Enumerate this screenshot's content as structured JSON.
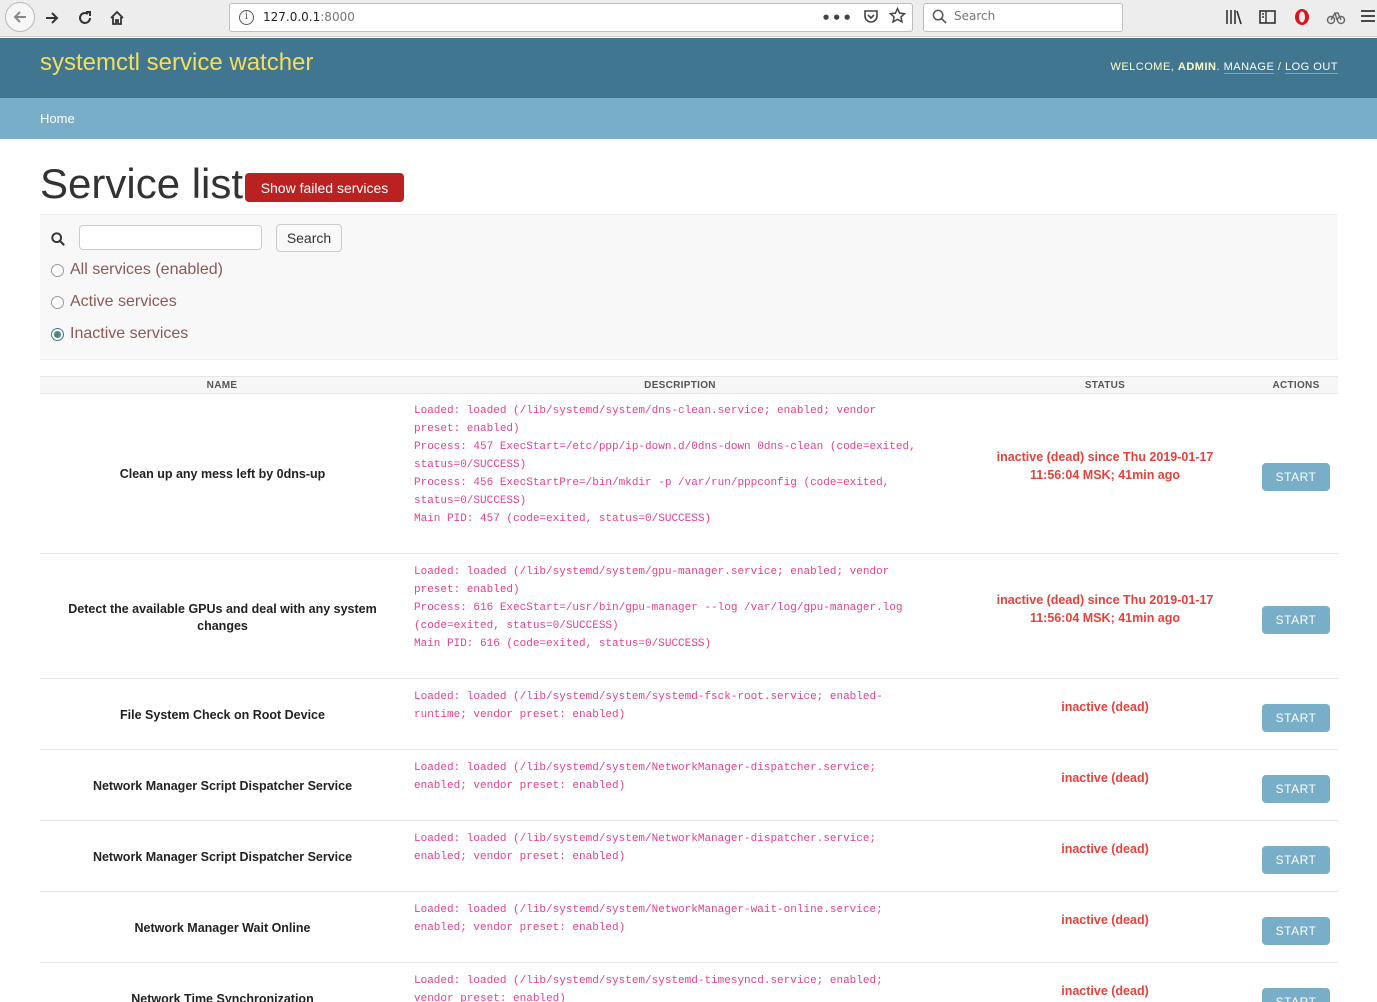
{
  "browser": {
    "url_host": "127.0.0.1",
    "url_port": ":8000",
    "search_placeholder": "Search"
  },
  "header": {
    "site_title": "systemctl service watcher",
    "welcome": "WELCOME,",
    "username": "ADMIN",
    "manage": "MANAGE",
    "separator": "/",
    "logout": "LOG OUT"
  },
  "breadcrumb": {
    "home": "Home"
  },
  "main": {
    "title": "Service list",
    "failed_button": "Show failed services"
  },
  "filter": {
    "search_value": "",
    "search_button": "Search",
    "options": [
      {
        "label": "All services (enabled)",
        "checked": false
      },
      {
        "label": "Active services",
        "checked": false
      },
      {
        "label": "Inactive services",
        "checked": true
      }
    ]
  },
  "table": {
    "headers": {
      "name": "NAME",
      "description": "DESCRIPTION",
      "status": "STATUS",
      "actions": "ACTIONS"
    },
    "rows": [
      {
        "name": "Clean up any mess left by 0dns-up",
        "description": "Loaded: loaded (/lib/systemd/system/dns-clean.service; enabled; vendor\npreset: enabled)\nProcess: 457 ExecStart=/etc/ppp/ip-down.d/0dns-down 0dns-clean (code=exited,\nstatus=0/SUCCESS)\nProcess: 456 ExecStartPre=/bin/mkdir -p /var/run/pppconfig (code=exited,\nstatus=0/SUCCESS)\nMain PID: 457 (code=exited, status=0/SUCCESS)",
        "status": "inactive (dead) since Thu 2019-01-17\n11:56:04 MSK; 41min ago",
        "action": "START"
      },
      {
        "name": "Detect the available GPUs and deal with any system\nchanges",
        "description": "Loaded: loaded (/lib/systemd/system/gpu-manager.service; enabled; vendor\npreset: enabled)\nProcess: 616 ExecStart=/usr/bin/gpu-manager --log /var/log/gpu-manager.log\n(code=exited, status=0/SUCCESS)\nMain PID: 616 (code=exited, status=0/SUCCESS)",
        "status": "inactive (dead) since Thu 2019-01-17\n11:56:04 MSK; 41min ago",
        "action": "START"
      },
      {
        "name": "File System Check on Root Device",
        "description": "Loaded: loaded (/lib/systemd/system/systemd-fsck-root.service; enabled-\nruntime; vendor preset: enabled)",
        "status": "inactive (dead)",
        "action": "START"
      },
      {
        "name": "Network Manager Script Dispatcher Service",
        "description": "Loaded: loaded (/lib/systemd/system/NetworkManager-dispatcher.service;\nenabled; vendor preset: enabled)",
        "status": "inactive (dead)",
        "action": "START"
      },
      {
        "name": "Network Manager Script Dispatcher Service",
        "description": "Loaded: loaded (/lib/systemd/system/NetworkManager-dispatcher.service;\nenabled; vendor preset: enabled)",
        "status": "inactive (dead)",
        "action": "START"
      },
      {
        "name": "Network Manager Wait Online",
        "description": "Loaded: loaded (/lib/systemd/system/NetworkManager-wait-online.service;\nenabled; vendor preset: enabled)",
        "status": "inactive (dead)",
        "action": "START"
      },
      {
        "name": "Network Time Synchronization",
        "description": "Loaded: loaded (/lib/systemd/system/systemd-timesyncd.service; enabled;\nvendor preset: enabled)",
        "status": "inactive (dead)",
        "action": "START"
      }
    ]
  }
}
